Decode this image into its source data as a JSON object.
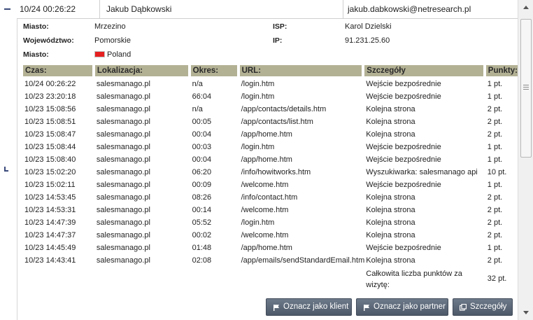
{
  "header": {
    "datetime": "10/24 00:26:22",
    "name": "Jakub Dąbkowski",
    "email": "jakub.dabkowski@netresearch.pl"
  },
  "info": {
    "miasto1_label": "Miasto:",
    "miasto1_value": "Mrzezino",
    "wojewodztwo_label": "Województwo:",
    "wojewodztwo_value": "Pomorskie",
    "miasto2_label": "Miasto:",
    "country_value": "Poland",
    "isp_label": "ISP:",
    "isp_value": "Karol Dzielski",
    "ip_label": "IP:",
    "ip_value": "91.231.25.60"
  },
  "table": {
    "columns": [
      "Czas:",
      "Lokalizacja:",
      "Okres:",
      "URL:",
      "Szczegóły",
      "Punkty:"
    ],
    "rows": [
      [
        "10/24 00:26:22",
        "salesmanago.pl",
        "n/a",
        "/login.htm",
        "Wejście bezpośrednie",
        "1 pt."
      ],
      [
        "10/23 23:20:18",
        "salesmanago.pl",
        "66:04",
        "/login.htm",
        "Wejście bezpośrednie",
        "1 pt."
      ],
      [
        "10/23 15:08:56",
        "salesmanago.pl",
        "n/a",
        "/app/contacts/details.htm",
        "Kolejna strona",
        "2 pt."
      ],
      [
        "10/23 15:08:51",
        "salesmanago.pl",
        "00:05",
        "/app/contacts/list.htm",
        "Kolejna strona",
        "2 pt."
      ],
      [
        "10/23 15:08:47",
        "salesmanago.pl",
        "00:04",
        "/app/home.htm",
        "Kolejna strona",
        "2 pt."
      ],
      [
        "10/23 15:08:44",
        "salesmanago.pl",
        "00:03",
        "/login.htm",
        "Wejście bezpośrednie",
        "1 pt."
      ],
      [
        "10/23 15:08:40",
        "salesmanago.pl",
        "00:04",
        "/app/home.htm",
        "Wejście bezpośrednie",
        "1 pt."
      ],
      [
        "10/23 15:02:20",
        "salesmanago.pl",
        "06:20",
        "/info/howitworks.htm",
        "Wyszukiwarka: salesmanago api",
        "10 pt."
      ],
      [
        "10/23 15:02:11",
        "salesmanago.pl",
        "00:09",
        "/welcome.htm",
        "Wejście bezpośrednie",
        "1 pt."
      ],
      [
        "10/23 14:53:45",
        "salesmanago.pl",
        "08:26",
        "/info/contact.htm",
        "Kolejna strona",
        "2 pt."
      ],
      [
        "10/23 14:53:31",
        "salesmanago.pl",
        "00:14",
        "/welcome.htm",
        "Kolejna strona",
        "2 pt."
      ],
      [
        "10/23 14:47:39",
        "salesmanago.pl",
        "05:52",
        "/login.htm",
        "Kolejna strona",
        "2 pt."
      ],
      [
        "10/23 14:47:37",
        "salesmanago.pl",
        "00:02",
        "/welcome.htm",
        "Kolejna strona",
        "2 pt."
      ],
      [
        "10/23 14:45:49",
        "salesmanago.pl",
        "01:48",
        "/app/home.htm",
        "Wejście bezpośrednie",
        "1 pt."
      ],
      [
        "10/23 14:43:41",
        "salesmanago.pl",
        "02:08",
        "/app/emails/sendStandardEmail.htm",
        "Kolejna strona",
        "2 pt."
      ]
    ],
    "total_label": "Całkowita liczba punktów za wizytę:",
    "total_value": "32 pt."
  },
  "buttons": {
    "mark_client": "Oznacz jako klient",
    "mark_partner": "Oznacz jako partner",
    "details": "Szczegóły"
  },
  "icons": {
    "collapse": "minus-icon",
    "tree": "tree-branch-icon",
    "flag": "poland-flag-icon",
    "mark": "flag-icon",
    "details": "window-icon"
  },
  "colors": {
    "table_header": "#b3b194",
    "button": "#5d6878"
  }
}
